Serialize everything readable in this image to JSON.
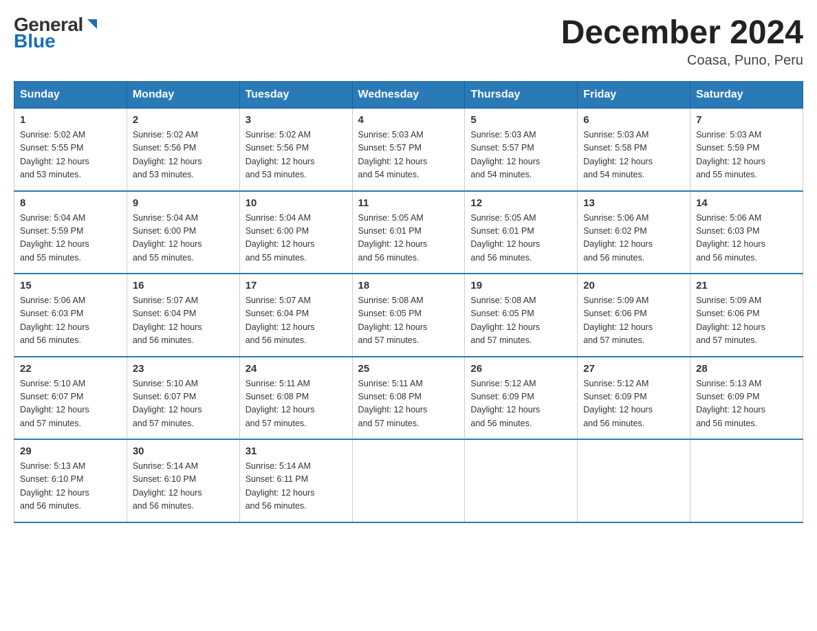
{
  "header": {
    "logo_general": "General",
    "logo_blue": "Blue",
    "month_year": "December 2024",
    "location": "Coasa, Puno, Peru"
  },
  "days_of_week": [
    "Sunday",
    "Monday",
    "Tuesday",
    "Wednesday",
    "Thursday",
    "Friday",
    "Saturday"
  ],
  "weeks": [
    [
      {
        "day": "1",
        "sunrise": "5:02 AM",
        "sunset": "5:55 PM",
        "daylight": "12 hours and 53 minutes."
      },
      {
        "day": "2",
        "sunrise": "5:02 AM",
        "sunset": "5:56 PM",
        "daylight": "12 hours and 53 minutes."
      },
      {
        "day": "3",
        "sunrise": "5:02 AM",
        "sunset": "5:56 PM",
        "daylight": "12 hours and 53 minutes."
      },
      {
        "day": "4",
        "sunrise": "5:03 AM",
        "sunset": "5:57 PM",
        "daylight": "12 hours and 54 minutes."
      },
      {
        "day": "5",
        "sunrise": "5:03 AM",
        "sunset": "5:57 PM",
        "daylight": "12 hours and 54 minutes."
      },
      {
        "day": "6",
        "sunrise": "5:03 AM",
        "sunset": "5:58 PM",
        "daylight": "12 hours and 54 minutes."
      },
      {
        "day": "7",
        "sunrise": "5:03 AM",
        "sunset": "5:59 PM",
        "daylight": "12 hours and 55 minutes."
      }
    ],
    [
      {
        "day": "8",
        "sunrise": "5:04 AM",
        "sunset": "5:59 PM",
        "daylight": "12 hours and 55 minutes."
      },
      {
        "day": "9",
        "sunrise": "5:04 AM",
        "sunset": "6:00 PM",
        "daylight": "12 hours and 55 minutes."
      },
      {
        "day": "10",
        "sunrise": "5:04 AM",
        "sunset": "6:00 PM",
        "daylight": "12 hours and 55 minutes."
      },
      {
        "day": "11",
        "sunrise": "5:05 AM",
        "sunset": "6:01 PM",
        "daylight": "12 hours and 56 minutes."
      },
      {
        "day": "12",
        "sunrise": "5:05 AM",
        "sunset": "6:01 PM",
        "daylight": "12 hours and 56 minutes."
      },
      {
        "day": "13",
        "sunrise": "5:06 AM",
        "sunset": "6:02 PM",
        "daylight": "12 hours and 56 minutes."
      },
      {
        "day": "14",
        "sunrise": "5:06 AM",
        "sunset": "6:03 PM",
        "daylight": "12 hours and 56 minutes."
      }
    ],
    [
      {
        "day": "15",
        "sunrise": "5:06 AM",
        "sunset": "6:03 PM",
        "daylight": "12 hours and 56 minutes."
      },
      {
        "day": "16",
        "sunrise": "5:07 AM",
        "sunset": "6:04 PM",
        "daylight": "12 hours and 56 minutes."
      },
      {
        "day": "17",
        "sunrise": "5:07 AM",
        "sunset": "6:04 PM",
        "daylight": "12 hours and 56 minutes."
      },
      {
        "day": "18",
        "sunrise": "5:08 AM",
        "sunset": "6:05 PM",
        "daylight": "12 hours and 57 minutes."
      },
      {
        "day": "19",
        "sunrise": "5:08 AM",
        "sunset": "6:05 PM",
        "daylight": "12 hours and 57 minutes."
      },
      {
        "day": "20",
        "sunrise": "5:09 AM",
        "sunset": "6:06 PM",
        "daylight": "12 hours and 57 minutes."
      },
      {
        "day": "21",
        "sunrise": "5:09 AM",
        "sunset": "6:06 PM",
        "daylight": "12 hours and 57 minutes."
      }
    ],
    [
      {
        "day": "22",
        "sunrise": "5:10 AM",
        "sunset": "6:07 PM",
        "daylight": "12 hours and 57 minutes."
      },
      {
        "day": "23",
        "sunrise": "5:10 AM",
        "sunset": "6:07 PM",
        "daylight": "12 hours and 57 minutes."
      },
      {
        "day": "24",
        "sunrise": "5:11 AM",
        "sunset": "6:08 PM",
        "daylight": "12 hours and 57 minutes."
      },
      {
        "day": "25",
        "sunrise": "5:11 AM",
        "sunset": "6:08 PM",
        "daylight": "12 hours and 57 minutes."
      },
      {
        "day": "26",
        "sunrise": "5:12 AM",
        "sunset": "6:09 PM",
        "daylight": "12 hours and 56 minutes."
      },
      {
        "day": "27",
        "sunrise": "5:12 AM",
        "sunset": "6:09 PM",
        "daylight": "12 hours and 56 minutes."
      },
      {
        "day": "28",
        "sunrise": "5:13 AM",
        "sunset": "6:09 PM",
        "daylight": "12 hours and 56 minutes."
      }
    ],
    [
      {
        "day": "29",
        "sunrise": "5:13 AM",
        "sunset": "6:10 PM",
        "daylight": "12 hours and 56 minutes."
      },
      {
        "day": "30",
        "sunrise": "5:14 AM",
        "sunset": "6:10 PM",
        "daylight": "12 hours and 56 minutes."
      },
      {
        "day": "31",
        "sunrise": "5:14 AM",
        "sunset": "6:11 PM",
        "daylight": "12 hours and 56 minutes."
      },
      null,
      null,
      null,
      null
    ]
  ],
  "labels": {
    "sunrise": "Sunrise:",
    "sunset": "Sunset:",
    "daylight": "Daylight:"
  }
}
